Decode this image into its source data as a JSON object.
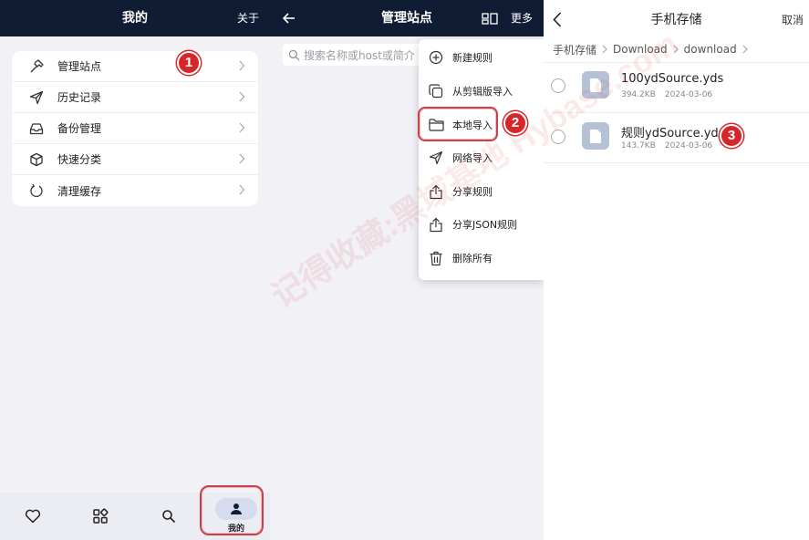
{
  "panel_profile": {
    "title": "我的",
    "header_right": "关于",
    "menu_items": [
      {
        "label": "管理站点",
        "icon": "hammer-icon"
      },
      {
        "label": "历史记录",
        "icon": "send-icon"
      },
      {
        "label": "备份管理",
        "icon": "inbox-icon"
      },
      {
        "label": "快速分类",
        "icon": "cube-icon"
      },
      {
        "label": "清理缓存",
        "icon": "refresh-icon"
      }
    ],
    "bottom_nav": [
      {
        "icon": "heart-icon"
      },
      {
        "icon": "grid-icon"
      },
      {
        "icon": "search-icon"
      },
      {
        "icon": "person-icon",
        "label": "我的"
      }
    ]
  },
  "panel_sites": {
    "title": "管理站点",
    "back_icon": "arrow-left-icon",
    "layout_icon": "layout-icon",
    "more_label": "更多",
    "search_placeholder": "搜索名称或host或简介",
    "menu": [
      {
        "label": "新建规则",
        "icon": "plus-circle-icon"
      },
      {
        "label": "从剪辑版导入",
        "icon": "copy-icon"
      },
      {
        "label": "本地导入",
        "icon": "folder-icon"
      },
      {
        "label": "网络导入",
        "icon": "send-icon"
      },
      {
        "label": "分享规则",
        "icon": "share-icon"
      },
      {
        "label": "分享JSON规则",
        "icon": "share-icon"
      },
      {
        "label": "删除所有",
        "icon": "trash-icon"
      }
    ]
  },
  "panel_files": {
    "title": "手机存储",
    "cancel": "取消",
    "breadcrumb": [
      "手机存储",
      "Download",
      "download"
    ],
    "files": [
      {
        "name": "100ydSource.yds",
        "size": "394.2KB",
        "date": "2024-03-06"
      },
      {
        "name": "规则ydSource.yds",
        "size": "143.7KB",
        "date": "2024-03-06"
      }
    ]
  },
  "callouts": [
    "1",
    "2",
    "3"
  ],
  "watermark": "记得收藏:黑域基地 Hybase.com",
  "colors": {
    "header_dark": "#101c33",
    "callout_red": "#d7262a",
    "background": "#f1f1f6"
  }
}
